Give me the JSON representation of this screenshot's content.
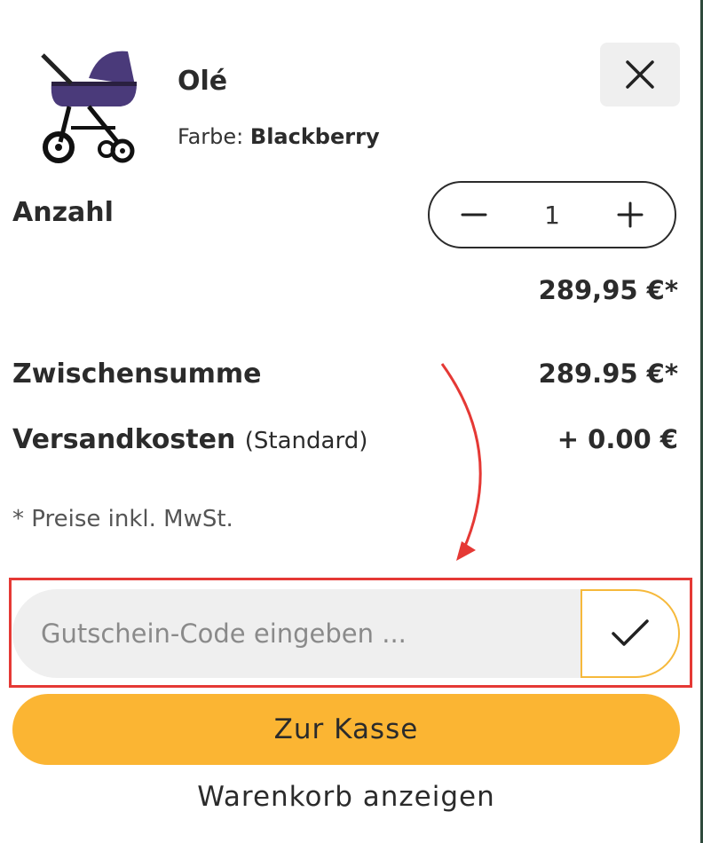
{
  "product": {
    "name": "Olé",
    "color_label": "Farbe:",
    "color_value": "Blackberry",
    "image_icon": "stroller-image"
  },
  "close": {
    "icon": "close-icon"
  },
  "quantity": {
    "label": "Anzahl",
    "value": "1"
  },
  "item_price": "289,95 €*",
  "summary": {
    "subtotal_label": "Zwischensumme",
    "subtotal_value": "289.95 €*",
    "shipping_label": "Versandkosten",
    "shipping_note": "(Standard)",
    "shipping_value": "+ 0.00 €"
  },
  "tax_note": "* Preise inkl. MwSt.",
  "coupon": {
    "placeholder": "Gutschein-Code eingeben ...",
    "submit_icon": "checkmark-icon"
  },
  "checkout_label": "Zur Kasse",
  "view_cart_label": "Warenkorb anzeigen",
  "colors": {
    "accent": "#fbb533",
    "annotation": "#e53935",
    "stroller": "#4a3a7a"
  }
}
